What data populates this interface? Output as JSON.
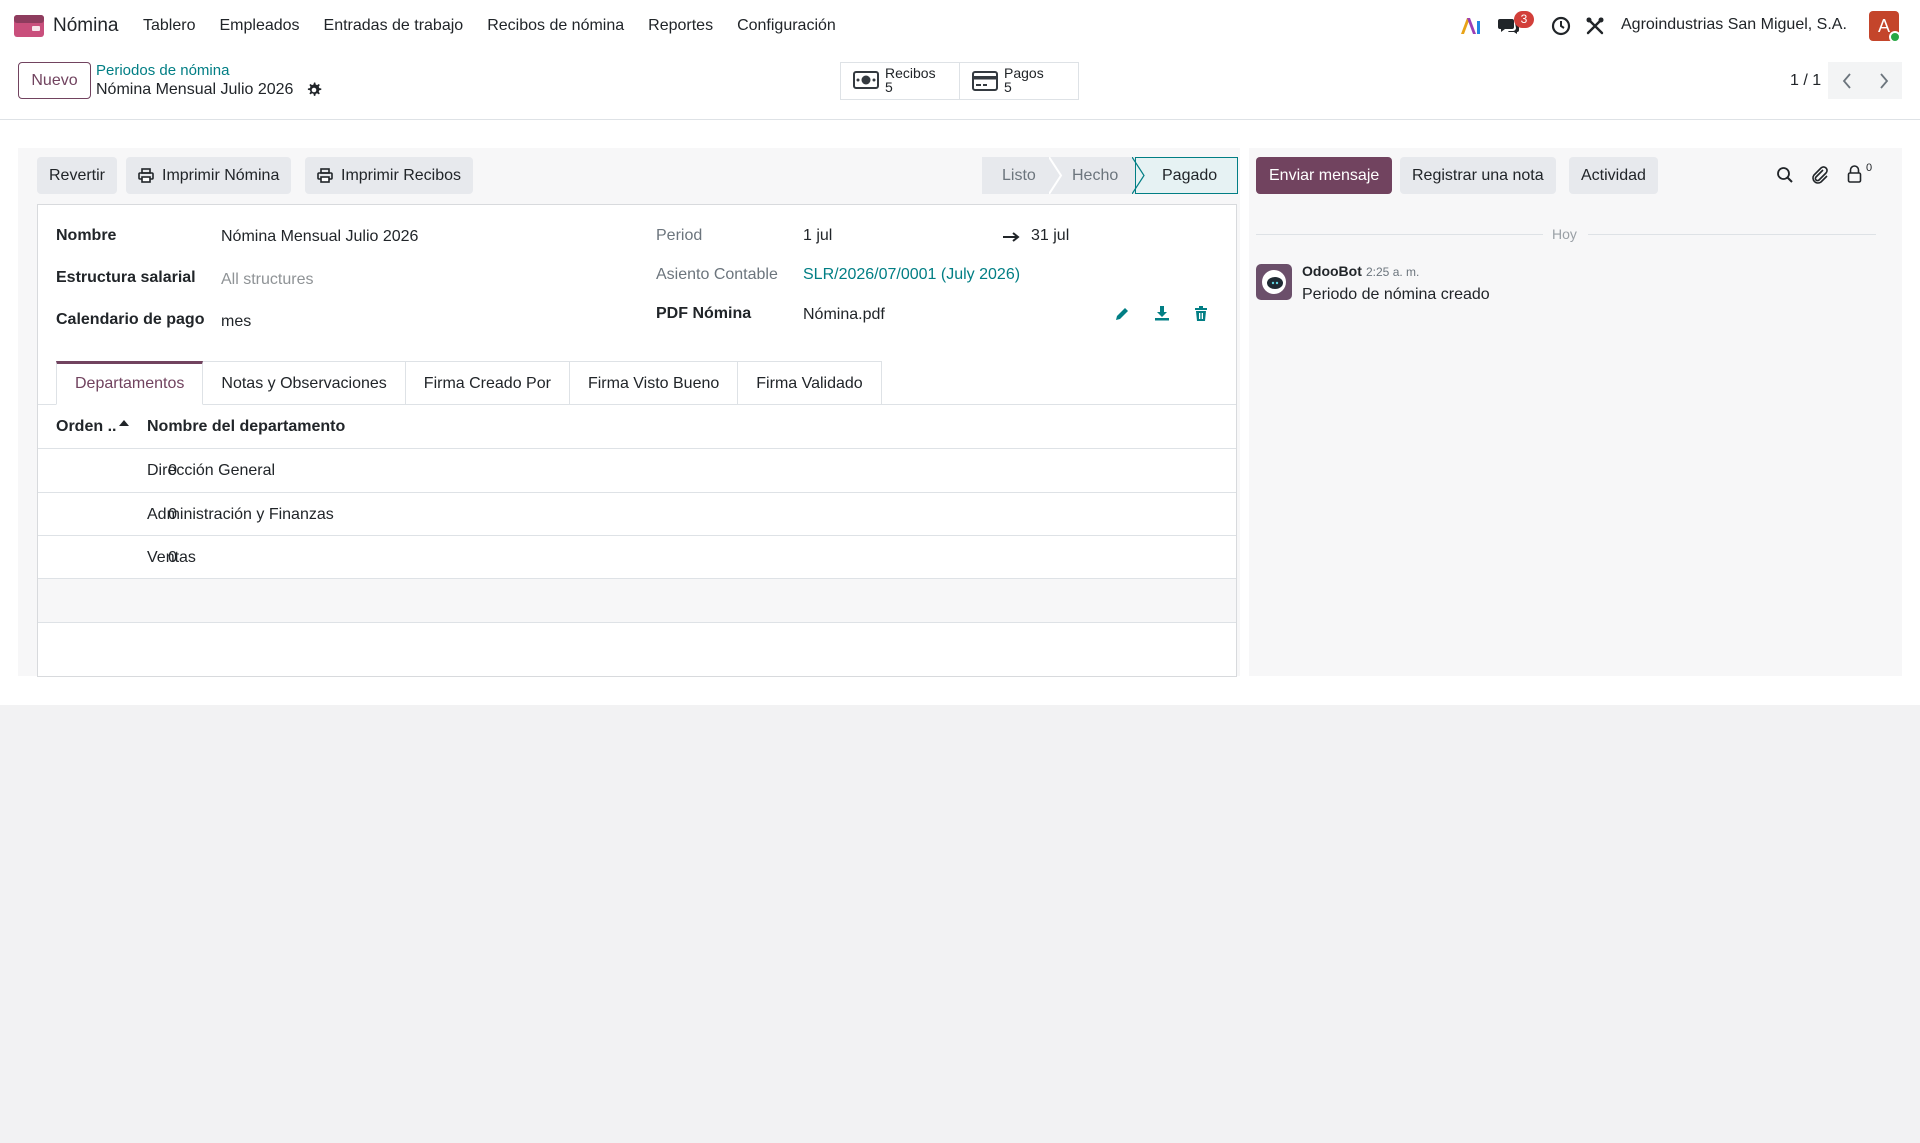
{
  "navbar": {
    "app_name": "Nómina",
    "menu": [
      "Tablero",
      "Empleados",
      "Entradas de trabajo",
      "Recibos de nómina",
      "Reportes",
      "Configuración"
    ],
    "messages_badge": "3",
    "company": "Agroindustrias San Miguel, S.A.",
    "avatar_letter": "A"
  },
  "control": {
    "new_label": "Nuevo",
    "breadcrumb_parent": "Periodos de nómina",
    "breadcrumb_current": "Nómina Mensual Julio 2026",
    "smart_buttons": [
      {
        "label": "Recibos",
        "count": "5",
        "icon": "money-icon"
      },
      {
        "label": "Pagos",
        "count": "5",
        "icon": "credit-card-icon"
      }
    ],
    "pager": "1 / 1"
  },
  "actions": {
    "revert": "Revertir",
    "print_payroll": "Imprimir Nómina",
    "print_receipts": "Imprimir Recibos"
  },
  "status": {
    "steps": [
      "Listo",
      "Hecho",
      "Pagado"
    ],
    "current": "Pagado"
  },
  "form": {
    "name_label": "Nombre",
    "name_value": "Nómina Mensual Julio 2026",
    "structure_label": "Estructura salarial",
    "structure_placeholder": "All structures",
    "calendar_label": "Calendario de pago",
    "calendar_value": "mes",
    "period_label": "Period",
    "period_start": "1 jul",
    "period_end": "31 jul",
    "entry_label": "Asiento Contable",
    "entry_value": "SLR/2026/07/0001 (July 2026)",
    "pdf_label": "PDF Nómina",
    "pdf_value": "Nómina.pdf"
  },
  "tabs": [
    "Departamentos",
    "Notas y Observaciones",
    "Firma Creado Por",
    "Firma Visto Bueno",
    "Firma Validado"
  ],
  "table": {
    "headers": [
      "Orden ..",
      "Nombre del departamento"
    ],
    "rows": [
      {
        "order": "0",
        "name": "Dirección General"
      },
      {
        "order": "0",
        "name": "Administración y Finanzas"
      },
      {
        "order": "0",
        "name": "Ventas"
      }
    ]
  },
  "chatter": {
    "send_message": "Enviar mensaje",
    "log_note": "Registrar una nota",
    "activity": "Actividad",
    "followers_count": "0",
    "day_separator": "Hoy",
    "messages": [
      {
        "author": "OdooBot",
        "time": "2:25 a. m.",
        "body": "Periodo de nómina creado"
      }
    ]
  },
  "colors": {
    "brand": "#71435f",
    "link": "#017e84"
  }
}
